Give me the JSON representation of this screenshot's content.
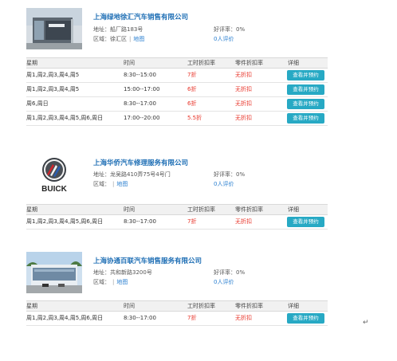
{
  "columns": {
    "days": "星期",
    "time": "时间",
    "labor": "工时折扣率",
    "parts": "零件折扣率",
    "detail": "详细"
  },
  "labels": {
    "address": "地址：",
    "area": "区域：",
    "rating": "好评率：",
    "map": "地图"
  },
  "dealers": [
    {
      "name": "上海绿地徐汇汽车销售有限公司",
      "address": "船厂路183号",
      "area": "徐汇区",
      "rating": "0%",
      "reviews": "0人评价",
      "rows": [
        {
          "days": "周1,周2,周3,周4,周5",
          "time": "8:30--15:00",
          "labor": "7折",
          "parts": "无折扣",
          "button": "查看并预约"
        },
        {
          "days": "周1,周2,周3,周4,周5",
          "time": "15:00--17:00",
          "labor": "6折",
          "parts": "无折扣",
          "button": "查看并预约"
        },
        {
          "days": "周6,周日",
          "time": "8:30--17:00",
          "labor": "6折",
          "parts": "无折扣",
          "button": "查看并预约"
        },
        {
          "days": "周1,周2,周3,周4,周5,周6,周日",
          "time": "17:00--20:00",
          "labor": "5.5折",
          "parts": "无折扣",
          "button": "查看并预约"
        }
      ]
    },
    {
      "name": "上海华侨汽车修理服务有限公司",
      "address": "龙吴路410弄75号4号门",
      "area": "",
      "rating": "0%",
      "reviews": "0人评价",
      "logo_text": "BUICK",
      "rows": [
        {
          "days": "周1,周2,周3,周4,周5,周6,周日",
          "time": "8:30--17:00",
          "labor": "7折",
          "parts": "无折扣",
          "button": "查看并预约"
        }
      ]
    },
    {
      "name": "上海协通百联汽车销售服务有限公司",
      "address": "共和新路3200号",
      "area": "",
      "rating": "0%",
      "reviews": "0人评价",
      "rows": [
        {
          "days": "周1,周2,周3,周4,周5,周6,周日",
          "time": "8:30--17:00",
          "labor": "7折",
          "parts": "无折扣",
          "button": "查看并预约"
        }
      ]
    }
  ],
  "colors": {
    "accent": "#1f6fb5",
    "discount": "#e8352a",
    "button": "#27a9c4"
  },
  "paragraph_mark": "↵"
}
